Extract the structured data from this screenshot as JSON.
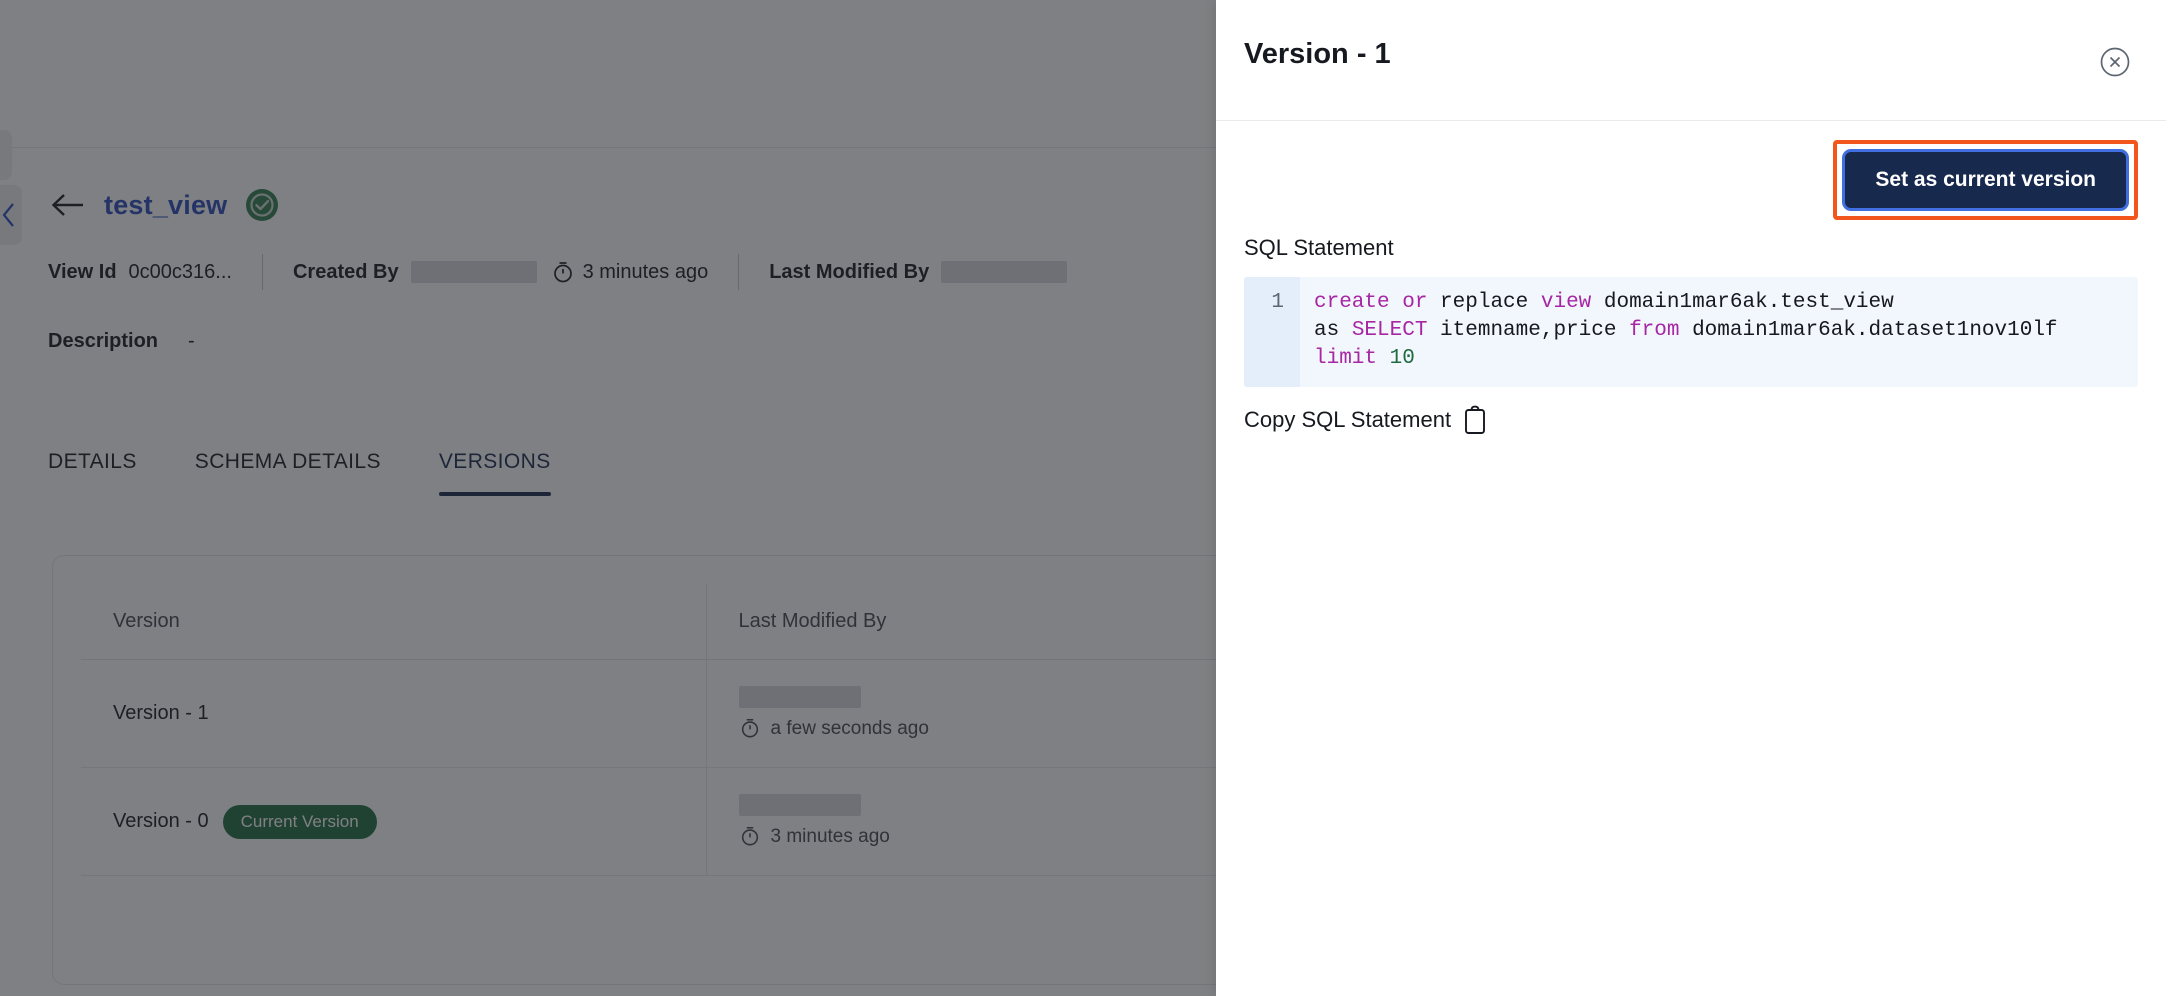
{
  "background": {
    "view_title": "test_view",
    "status_icon": "check-circle-icon",
    "back_icon": "back-arrow-icon",
    "meta": {
      "view_id_label": "View Id",
      "view_id_value": "0c00c316...",
      "created_by_label": "Created By",
      "created_by_value": "",
      "created_ago": "3 minutes ago",
      "last_modified_by_label": "Last Modified By",
      "last_modified_by_value": "",
      "description_label": "Description",
      "description_value": "-"
    },
    "tabs": [
      {
        "label": "DETAILS",
        "active": false
      },
      {
        "label": "SCHEMA DETAILS",
        "active": false
      },
      {
        "label": "VERSIONS",
        "active": true
      }
    ],
    "versions_table": {
      "columns": [
        "Version",
        "Last Modified By"
      ],
      "rows": [
        {
          "version": "Version - 1",
          "badge": "",
          "modified_by": "",
          "modified_ago": "a few seconds ago"
        },
        {
          "version": "Version - 0",
          "badge": "Current Version",
          "modified_by": "",
          "modified_ago": "3 minutes ago"
        }
      ]
    }
  },
  "panel": {
    "title": "Version - 1",
    "close_icon": "close-circle-icon",
    "set_current_button": "Set as current version",
    "sql_label": "SQL Statement",
    "line_number": "1",
    "sql_tokens": [
      {
        "t": "create or ",
        "k": true
      },
      {
        "t": "replace ",
        "k": false
      },
      {
        "t": "view ",
        "k": true
      },
      {
        "t": "domain1mar6ak.test_view\nas ",
        "k": false
      },
      {
        "t": "SELECT ",
        "k": true
      },
      {
        "t": "itemname,price ",
        "k": false
      },
      {
        "t": "from ",
        "k": true
      },
      {
        "t": "domain1mar6ak.dataset1nov10lf ",
        "k": false
      },
      {
        "t": "limit ",
        "k": true
      },
      {
        "t": "10",
        "k": false,
        "n": true
      }
    ],
    "sql_plain": "create or replace view domain1mar6ak.test_view as SELECT itemname,price from domain1mar6ak.dataset1nov10lf limit 10",
    "copy_label": "Copy SQL Statement",
    "copy_icon": "clipboard-icon"
  },
  "colors": {
    "accent_blue": "#2a4bbd",
    "panel_button": "#17294d",
    "focus_ring": "#3f6fe0",
    "highlight": "#f2561d",
    "badge_green": "#1d6b3f",
    "code_bg": "#f2f7fd",
    "keyword": "#a626a4",
    "number": "#1d6b3f"
  }
}
